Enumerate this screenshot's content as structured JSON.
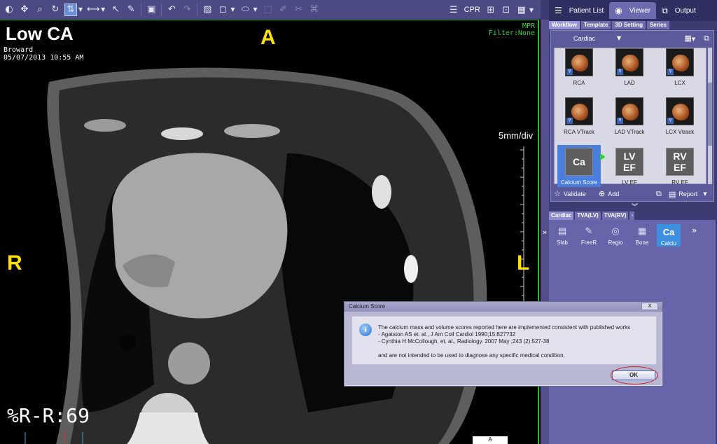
{
  "toolbar": {
    "tools_left": [
      {
        "name": "window-level-icon",
        "glyph": "◐"
      },
      {
        "name": "pan-icon",
        "glyph": "✥"
      },
      {
        "name": "zoom-icon",
        "glyph": "🔍"
      },
      {
        "name": "rotate-icon",
        "glyph": "↻"
      },
      {
        "name": "scroll-icon",
        "glyph": "⇅",
        "active": true
      }
    ],
    "cpr_label": "CPR"
  },
  "viewport": {
    "title": "Low CA",
    "site": "Broward",
    "datetime": "05/07/2013 10:55 AM",
    "mode": "MPR",
    "filter": "Filter:None",
    "orient_top": "A",
    "orient_left": "R",
    "orient_right": "L",
    "scale": "5mm/div",
    "hr": "%R-R:69",
    "bottom_label": "A"
  },
  "top_tabs": {
    "patient_list": "Patient List",
    "viewer": "Viewer",
    "output": "Output"
  },
  "workflow_tabs": [
    "Workflow",
    "Template",
    "3D Setting",
    "Series"
  ],
  "workflow": {
    "selected": "Cardiac",
    "thumbs": [
      {
        "label": "RCA",
        "kind": "img"
      },
      {
        "label": "LAD",
        "kind": "img"
      },
      {
        "label": "LCX",
        "kind": "img"
      },
      {
        "label": "RCA VTrack",
        "kind": "img"
      },
      {
        "label": "LAD VTrack",
        "kind": "img"
      },
      {
        "label": "LCX Vtrack",
        "kind": "img"
      },
      {
        "label": "Calcium Score",
        "kind": "tile",
        "tile": "Ca",
        "selected": true
      },
      {
        "label": "LV EF",
        "kind": "tile",
        "tile": "LV EF"
      },
      {
        "label": "RV EF",
        "kind": "tile",
        "tile": "RV EF"
      }
    ],
    "validate": "Validate",
    "add": "Add",
    "report": "Report"
  },
  "tool_tabs": [
    "Cardiac",
    "TVA(LV)",
    "TVA(RV)"
  ],
  "tools": [
    {
      "label": "Slab",
      "glyph": "▤"
    },
    {
      "label": "FreeR",
      "glyph": "✎"
    },
    {
      "label": "Regio",
      "glyph": "◎"
    },
    {
      "label": "Bone",
      "glyph": "▦"
    },
    {
      "label": "Calciu",
      "glyph": "Ca",
      "active": true
    }
  ],
  "dialog": {
    "title": "Calcium Score",
    "line1": "The calcium mass and volume scores reported here are implemented consistent with published works",
    "line2": "- Agatston AS et. al., J Am Coll Cardiol 1990;15:827?32",
    "line3": "- Cynthia H McCollough, et. al., Radiology. 2007 May ;243 (2):527-38",
    "line4": "and are not intended to be used to diagnose any specific medical condition.",
    "ok": "OK",
    "close": "x"
  }
}
